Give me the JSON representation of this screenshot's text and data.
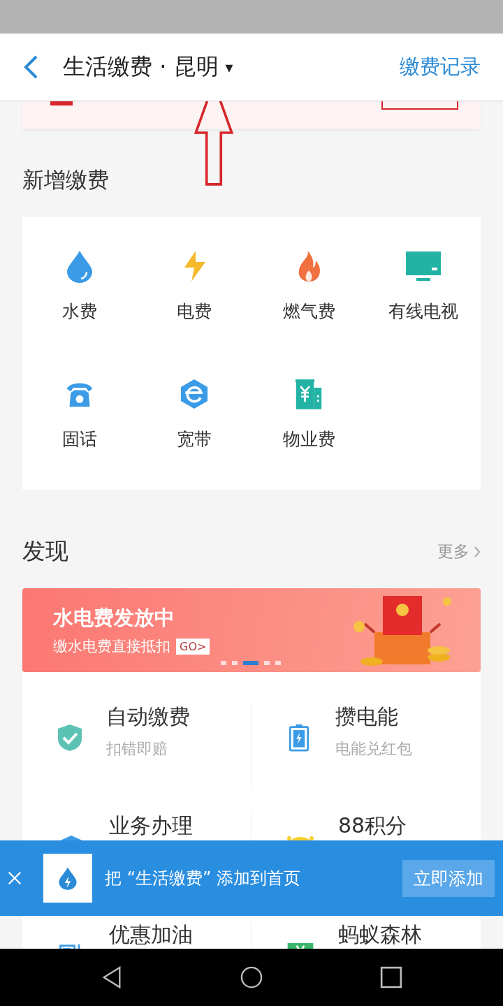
{
  "header": {
    "title": "生活缴费 · 昆明",
    "dropdown": "▾",
    "action": "缴费记录"
  },
  "new_payment": {
    "title": "新增缴费",
    "items": [
      {
        "kind": "water",
        "label": "水费"
      },
      {
        "kind": "power",
        "label": "电费"
      },
      {
        "kind": "gas",
        "label": "燃气费"
      },
      {
        "kind": "tv",
        "label": "有线电视"
      },
      {
        "kind": "phone",
        "label": "固话"
      },
      {
        "kind": "broadband",
        "label": "宽带"
      },
      {
        "kind": "property",
        "label": "物业费"
      }
    ]
  },
  "discover": {
    "title": "发现",
    "more": "更多"
  },
  "banner": {
    "title": "水电费发放中",
    "subtitle": "缴水电费直接抵扣",
    "button": "GO>",
    "dots": [
      {
        "selected": false
      },
      {
        "selected": false
      },
      {
        "selected": true
      },
      {
        "selected": false
      },
      {
        "selected": false
      }
    ]
  },
  "services": [
    {
      "kind": "shield",
      "title": "自动缴费",
      "subtitle": "扣错即赔"
    },
    {
      "kind": "battery",
      "title": "攒电能",
      "subtitle": "电能兑红包"
    },
    {
      "kind": "layers",
      "title": "业务办理"
    },
    {
      "kind": "chick",
      "title": "88积分"
    },
    {
      "kind": "fuel",
      "title": "优惠加油"
    },
    {
      "kind": "forest",
      "title": "蚂蚁森林"
    }
  ],
  "toast": {
    "text": "把 “生活缴费” 添加到首页",
    "button": "立即添加"
  }
}
